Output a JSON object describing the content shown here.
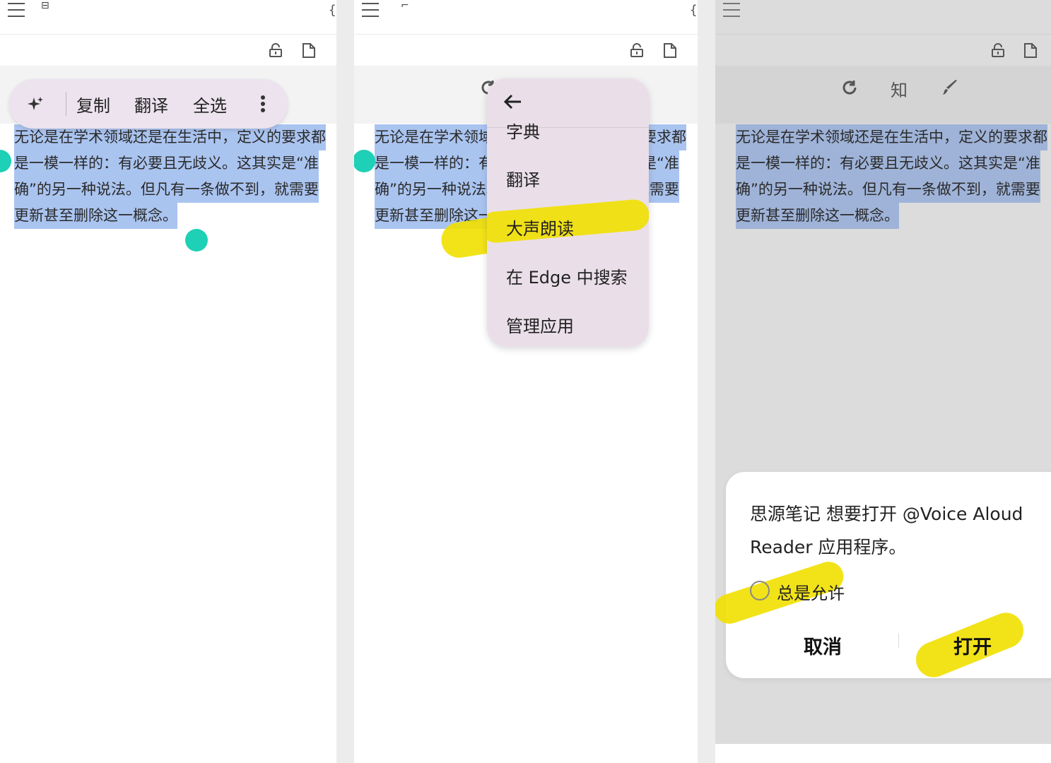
{
  "panel1": {
    "toolbar_mini": "⊟",
    "selection_lines": [
      "无论是在学术领域还是在生活中，定义的要求都",
      "是一模一样的：有必要且无歧义。这其实是“准",
      "确”的另一种说法。但凡有一条做不到，就需要",
      "更新甚至删除这一概念。"
    ],
    "popup_items": {
      "copy": "复制",
      "translate": "翻译",
      "select_all": "全选"
    }
  },
  "panel2": {
    "toolbar_mini": "⌐",
    "selection_lines": [
      "无论是在学术领域还是在生活中，定义的要求都",
      "是一模一样的：有必要且无歧义。这其实是“准",
      "确”的另一种说法。但凡有一条做不到，就需要",
      "更新甚至删除这一概念。"
    ],
    "menu_items": {
      "dictionary": "字典",
      "translate": "翻译",
      "read_aloud": "大声朗读",
      "search_edge": "在 Edge 中搜索",
      "manage_apps": "管理应用"
    }
  },
  "panel3": {
    "toolbar_icons": {
      "zhi": "知"
    },
    "selection_lines": [
      "无论是在学术领域还是在生活中，定义的要求都",
      "是一模一样的：有必要且无歧义。这其实是“准",
      "确”的另一种说法。但凡有一条做不到，就需要",
      "更新甚至删除这一概念。"
    ],
    "dialog": {
      "message": "思源笔记 想要打开 @Voice Aloud Reader 应用程序。",
      "always_allow": "总是允许",
      "cancel": "取消",
      "open": "打开"
    }
  },
  "colors": {
    "highlight": "#f1e000",
    "selection": "#aac4f0",
    "handle": "#1ed0b5"
  }
}
